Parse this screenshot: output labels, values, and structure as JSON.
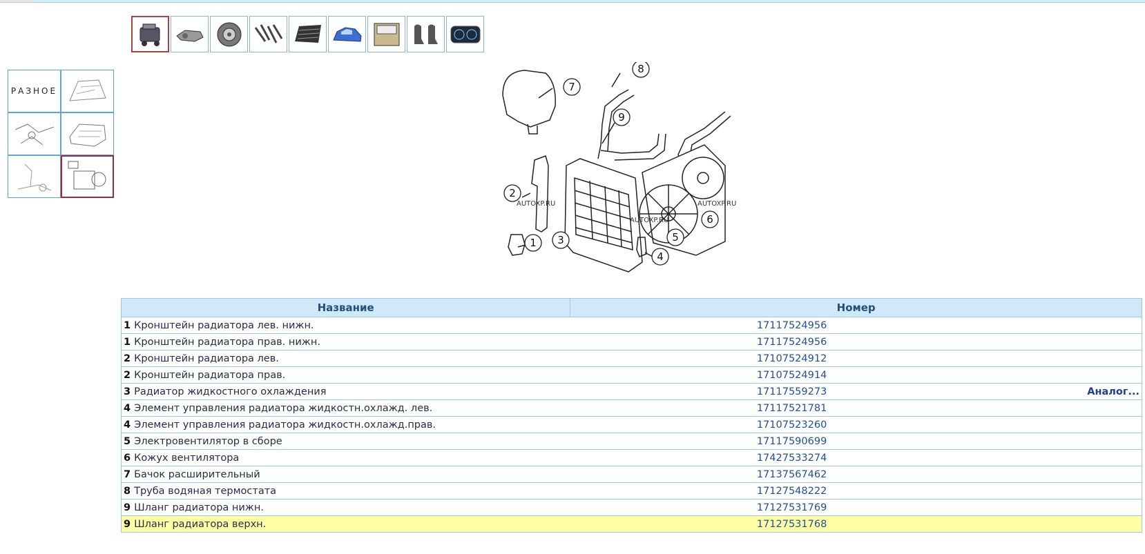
{
  "categories": [
    {
      "icon": "engine-icon",
      "selected": true
    },
    {
      "icon": "transmission-icon",
      "selected": false
    },
    {
      "icon": "wheel-icon",
      "selected": false
    },
    {
      "icon": "exhaust-icon",
      "selected": false
    },
    {
      "icon": "radiator-grille-icon",
      "selected": false
    },
    {
      "icon": "car-body-icon",
      "selected": false
    },
    {
      "icon": "door-icon",
      "selected": false
    },
    {
      "icon": "seats-icon",
      "selected": false
    },
    {
      "icon": "dashboard-icon",
      "selected": false
    }
  ],
  "subcategories": [
    {
      "label": "РАЗНОЕ",
      "icon": "misc-text-tile"
    },
    {
      "icon": "engine-parts-thumb"
    },
    {
      "icon": "mount-bracket-thumb"
    },
    {
      "icon": "cylinder-head-thumb"
    },
    {
      "icon": "pump-thumb"
    },
    {
      "icon": "radiator-assembly-thumb",
      "selected": true
    }
  ],
  "diagram": {
    "watermark": "AUTOXP.RU",
    "callouts": [
      "1",
      "2",
      "3",
      "4",
      "5",
      "6",
      "7",
      "8",
      "9"
    ]
  },
  "table": {
    "headers": {
      "name": "Название",
      "number": "Номер"
    },
    "analog_label": "Аналог...",
    "rows": [
      {
        "num": "1",
        "name": "Кронштейн радиатора лев. нижн.",
        "part": "17117524956"
      },
      {
        "num": "1",
        "name": "Кронштейн радиатора прав. нижн.",
        "part": "17117524956"
      },
      {
        "num": "2",
        "name": "Кронштейн радиатора лев.",
        "part": "17107524912"
      },
      {
        "num": "2",
        "name": "Кронштейн радиатора прав.",
        "part": "17107524914"
      },
      {
        "num": "3",
        "name": "Радиатор жидкостного охлаждения",
        "part": "17117559273",
        "analog": true
      },
      {
        "num": "4",
        "name": "Элемент управления радиатора жидкостн.охлажд. лев.",
        "part": "17117521781"
      },
      {
        "num": "4",
        "name": "Элемент управления радиатора жидкостн.охлажд.прав.",
        "part": "17107523260"
      },
      {
        "num": "5",
        "name": "Электровентилятор в сборе",
        "part": "17117590699"
      },
      {
        "num": "6",
        "name": "Кожух вентилятора",
        "part": "17427533274"
      },
      {
        "num": "7",
        "name": "Бачок расширительный",
        "part": "17137567462"
      },
      {
        "num": "8",
        "name": "Труба водяная термостата",
        "part": "17127548222"
      },
      {
        "num": "9",
        "name": "Шланг радиатора нижн.",
        "part": "17127531769"
      },
      {
        "num": "9",
        "name": "Шланг радиатора верхн.",
        "part": "17127531768",
        "highlight": true
      }
    ]
  },
  "colors": {
    "header_bg": "#cfe8fa",
    "highlight_row": "#ffffa6",
    "selected_border": "#b04040",
    "link": "#1f4f9a"
  }
}
